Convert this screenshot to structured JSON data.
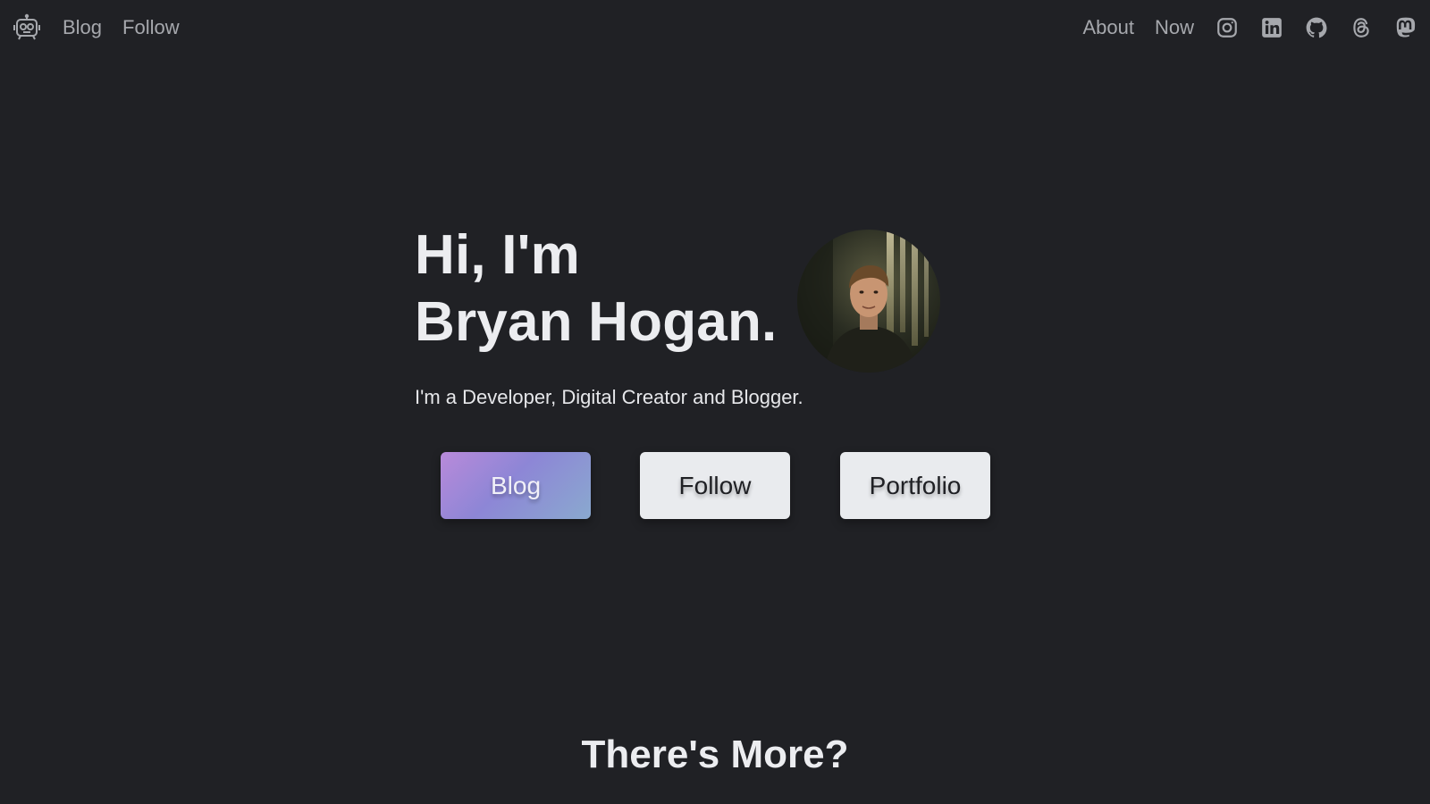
{
  "nav": {
    "logo_icon": "robot-logo-icon",
    "left_links": [
      "Blog",
      "Follow"
    ],
    "right_links": [
      "About",
      "Now"
    ],
    "social_icons": [
      "instagram-icon",
      "linkedin-icon",
      "github-icon",
      "threads-icon",
      "mastodon-icon"
    ]
  },
  "hero": {
    "title_line1": "Hi, I'm",
    "title_line2": "Bryan Hogan.",
    "tagline": "I'm a Developer, Digital Creator and Blogger.",
    "buttons": {
      "blog": "Blog",
      "follow": "Follow",
      "portfolio": "Portfolio"
    }
  },
  "more": {
    "title": "There's More?"
  },
  "colors": {
    "background": "#202125",
    "nav_text": "#a6a8ad",
    "heading_text": "#ecedf0",
    "light_button": "#e9ebee",
    "gradient_start": "#b98ada",
    "gradient_end": "#8aa9cf"
  }
}
